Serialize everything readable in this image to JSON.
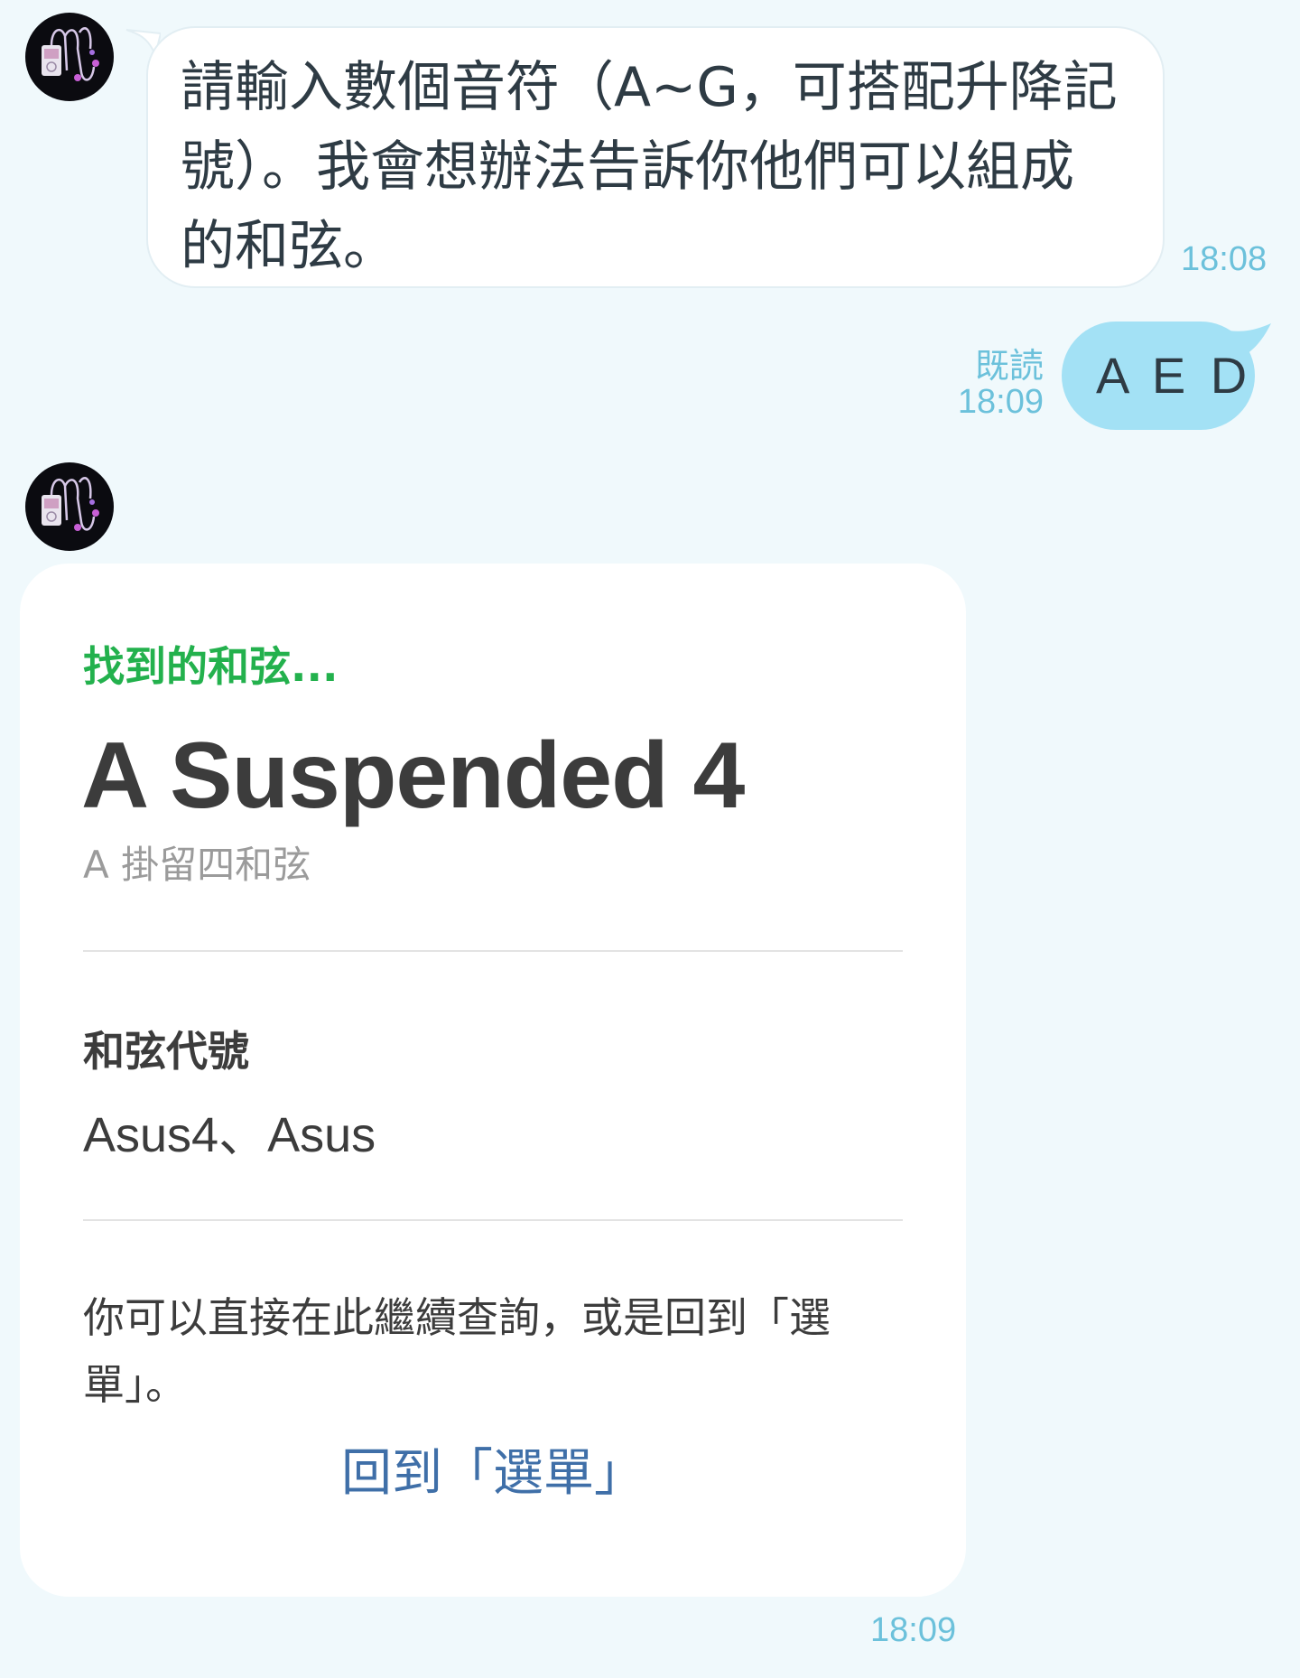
{
  "bot_message": {
    "lines": [
      "請輸入數個音符（A~G，可搭配升降記",
      "號）。我會想辦法告訴你他們可以組成",
      "的和弦。"
    ],
    "time": "18:08"
  },
  "user_message": {
    "read_status": "既読",
    "time": "18:09",
    "text": "A E D"
  },
  "result_card": {
    "eyebrow": "找到的和弦...",
    "title": "A Suspended 4",
    "subtitle": "A 掛留四和弦",
    "section_label": "和弦代號",
    "section_value": "Asus4、Asus",
    "note_lines": [
      "你可以直接在此繼續查詢，或是回到「選",
      "單」。"
    ],
    "link_label": "回到「選單」",
    "time": "18:09"
  },
  "colors": {
    "background": "#f0f9fc",
    "user_bubble": "#a3e1f5",
    "timestamp": "#6cc1db",
    "eyebrow_green": "#23b14d",
    "link_blue": "#3f6fa8"
  },
  "icons": {
    "avatar": "music-player-avatar-icon"
  }
}
